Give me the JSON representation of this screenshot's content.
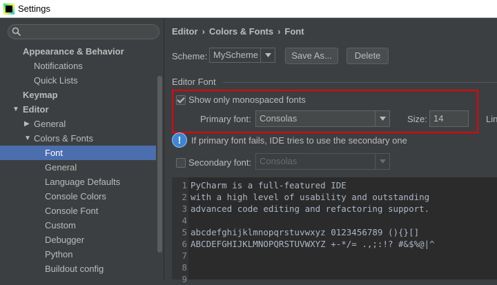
{
  "window": {
    "title": "Settings"
  },
  "sidebar": {
    "search_placeholder": "",
    "items": [
      {
        "label": "Appearance & Behavior",
        "level": 1,
        "bold": true
      },
      {
        "label": "Notifications",
        "level": 2
      },
      {
        "label": "Quick Lists",
        "level": 2
      },
      {
        "label": "Keymap",
        "level": 1,
        "bold": true
      },
      {
        "label": "Editor",
        "level": 1,
        "bold": true,
        "expanded": true
      },
      {
        "label": "General",
        "level": 2,
        "collapsed": true
      },
      {
        "label": "Colors & Fonts",
        "level": 2,
        "expanded": true
      },
      {
        "label": "Font",
        "level": 3,
        "selected": true
      },
      {
        "label": "General",
        "level": 3
      },
      {
        "label": "Language Defaults",
        "level": 3
      },
      {
        "label": "Console Colors",
        "level": 3
      },
      {
        "label": "Console Font",
        "level": 3
      },
      {
        "label": "Custom",
        "level": 3
      },
      {
        "label": "Debugger",
        "level": 3
      },
      {
        "label": "Python",
        "level": 3
      },
      {
        "label": "Buildout config",
        "level": 3
      }
    ]
  },
  "breadcrumb": {
    "parts": [
      "Editor",
      "Colors & Fonts",
      "Font"
    ],
    "separator": "›"
  },
  "scheme": {
    "label": "Scheme:",
    "value": "MyScheme",
    "save_as": "Save As...",
    "delete": "Delete"
  },
  "editor_font": {
    "section_title": "Editor Font",
    "show_mono_label": "Show only monospaced fonts",
    "show_mono_checked": true,
    "primary_label": "Primary font:",
    "primary_value": "Consolas",
    "size_label": "Size:",
    "size_value": "14",
    "line_spacing_label": "Lin",
    "info_text": "If primary font fails, IDE tries to use the secondary one",
    "secondary_label": "Secondary font:",
    "secondary_checked": false,
    "secondary_value": "Consolas"
  },
  "preview": {
    "lines": [
      {
        "n": "1",
        "text": "PyCharm is a full-featured IDE"
      },
      {
        "n": "2",
        "text": "with a high level of usability and outstanding"
      },
      {
        "n": "3",
        "text": "advanced code editing and refactoring support."
      },
      {
        "n": "4",
        "text": ""
      },
      {
        "n": "5",
        "text": "abcdefghijklmnopqrstuvwxyz 0123456789 (){}[]"
      },
      {
        "n": "6",
        "text": "ABCDEFGHIJKLMNOPQRSTUVWXYZ +-*/= .,;:!? #&$%@|^"
      },
      {
        "n": "7",
        "text": ""
      },
      {
        "n": "8",
        "text": ""
      },
      {
        "n": "9",
        "text": ""
      }
    ]
  },
  "colors": {
    "background": "#3c3f41",
    "selection": "#4b6eaf",
    "editor_bg": "#2b2b2b",
    "highlight_border": "#e8000a",
    "info_icon": "#3e86d4"
  }
}
